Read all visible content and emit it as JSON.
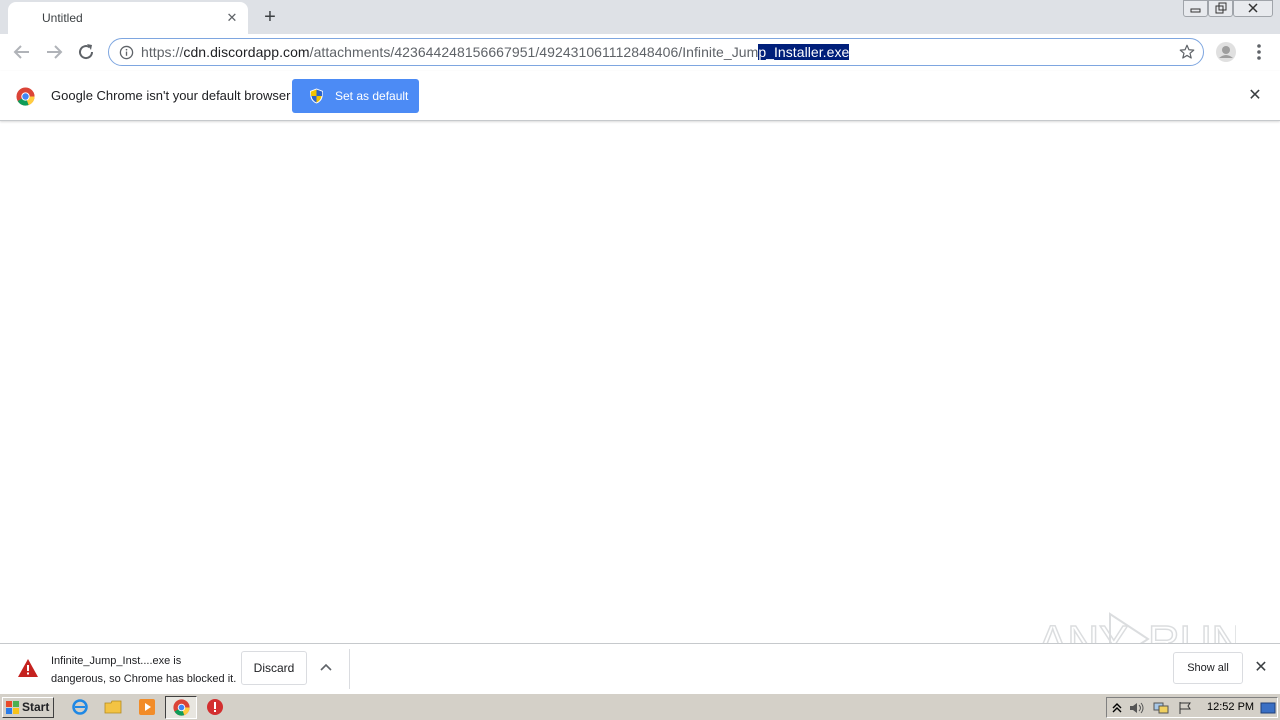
{
  "tab": {
    "title": "Untitled",
    "close_glyph": "✕",
    "new_tab_glyph": "+"
  },
  "window_controls": [
    "minimize-icon",
    "restore-icon",
    "close-icon"
  ],
  "toolbar": {
    "url_scheme": "https://",
    "url_domain": "cdn.discordapp.com",
    "url_path_plain": "/attachments/423644248156667951/492431061112848406/Infinite_Jum",
    "url_path_selected": "p_Installer.exe",
    "icons": [
      "back-icon",
      "forward-icon",
      "reload-icon",
      "site-info-icon",
      "star-icon",
      "profile-avatar-icon",
      "menu-dots-icon"
    ]
  },
  "infobar": {
    "message": "Google Chrome isn't your default browser",
    "button_label": "Set as default",
    "close_glyph": "✕"
  },
  "download_shelf": {
    "line1": "Infinite_Jump_Inst....exe is",
    "line2": "dangerous, so Chrome has blocked it.",
    "discard_label": "Discard",
    "show_all_label": "Show all",
    "close_glyph": "✕"
  },
  "watermark": {
    "text": "ANY RUN"
  },
  "taskbar": {
    "start_label": "Start",
    "clock": "12:52 PM",
    "pinned": [
      "internet-explorer-icon",
      "explorer-folder-icon",
      "media-player-icon",
      "chrome-icon",
      "stop-icon"
    ]
  },
  "colors": {
    "accent": "#4c8bf5",
    "selection": "#001f7a",
    "warning": "#c5221f",
    "taskbar": "#d4d0c8"
  }
}
